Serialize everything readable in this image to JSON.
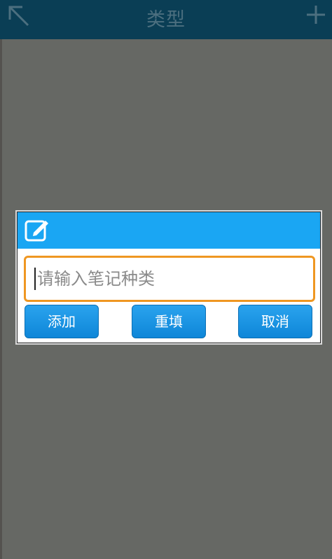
{
  "topbar": {
    "title": "类型",
    "back_icon": "back-arrow-icon",
    "add_icon": "plus-icon"
  },
  "dialog": {
    "header_icon": "edit-note-icon",
    "input": {
      "placeholder": "请输入笔记种类",
      "value": ""
    },
    "buttons": {
      "add": "添加",
      "reset": "重填",
      "cancel": "取消"
    }
  },
  "colors": {
    "topbar": "#0a3e55",
    "overlay": "#666864",
    "dialog_header": "#1aa6f3",
    "input_border": "#ef9722",
    "button": "#1594e2"
  }
}
